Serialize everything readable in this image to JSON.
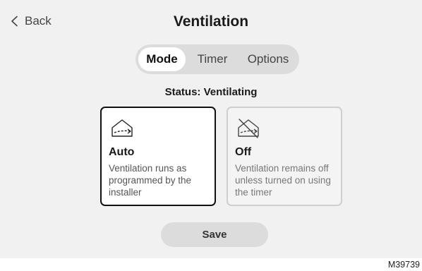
{
  "header": {
    "back_label": "Back",
    "title": "Ventilation"
  },
  "tabs": [
    {
      "label": "Mode",
      "active": true
    },
    {
      "label": "Timer",
      "active": false
    },
    {
      "label": "Options",
      "active": false
    }
  ],
  "status_text": "Status: Ventilating",
  "modes": [
    {
      "title": "Auto",
      "description": "Ventilation runs as programmed by the installer",
      "icon": "house-ventilation-icon",
      "selected": true
    },
    {
      "title": "Off",
      "description": "Ventilation remains off unless turned on using the timer",
      "icon": "house-ventilation-off-icon",
      "selected": false
    }
  ],
  "save_label": "Save",
  "figure_id": "M39739",
  "colors": {
    "background": "#f1f1f1",
    "selected_border": "#111111",
    "unselected_border": "#cfcfcf",
    "tab_track": "#dcdcdc",
    "button": "#dcdcdc"
  }
}
